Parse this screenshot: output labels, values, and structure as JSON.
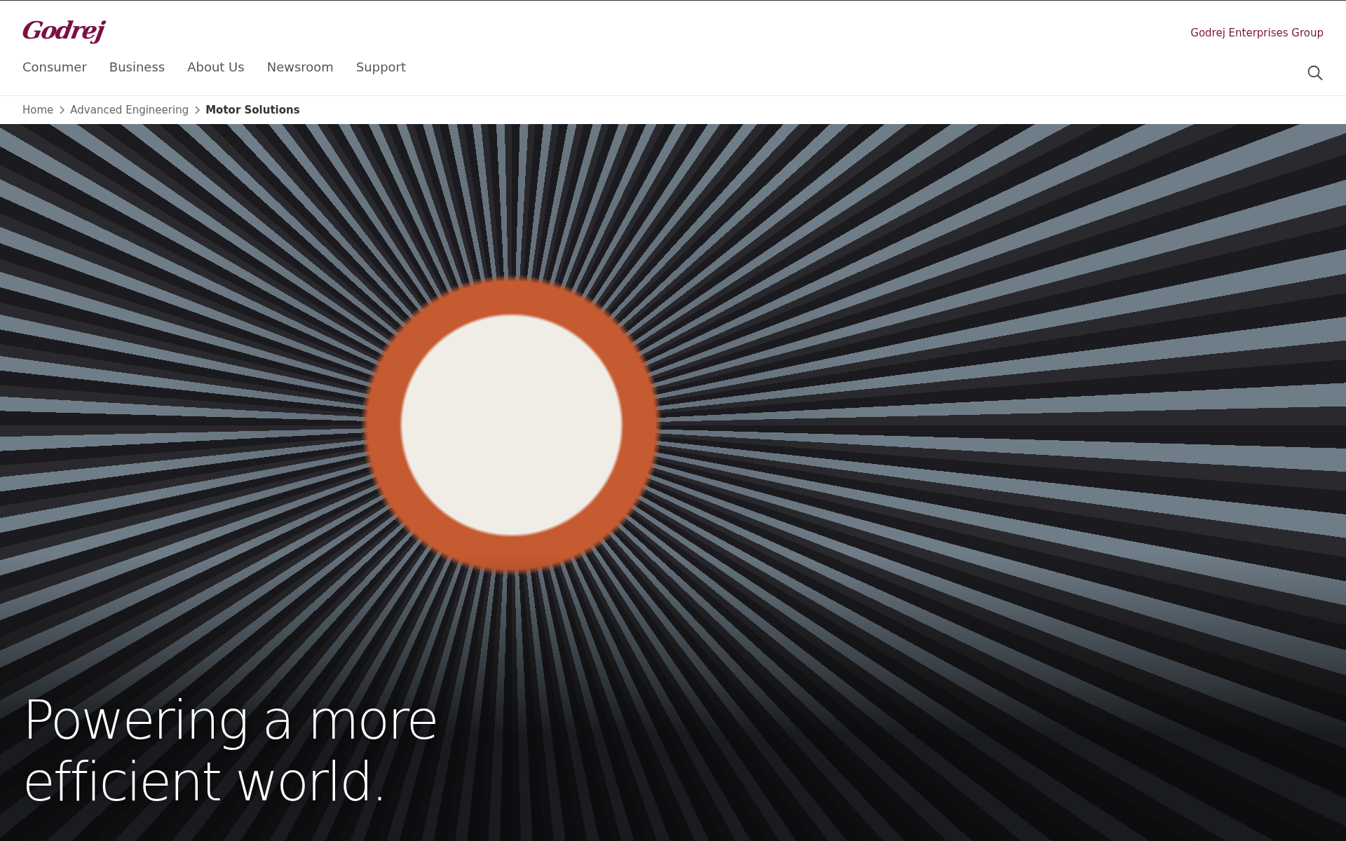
{
  "header": {
    "logo": "Godrej",
    "group_link": "Godrej Enterprises Group",
    "nav": [
      {
        "label": "Consumer"
      },
      {
        "label": "Business"
      },
      {
        "label": "About Us"
      },
      {
        "label": "Newsroom"
      },
      {
        "label": "Support"
      }
    ]
  },
  "breadcrumb": [
    {
      "label": "Home",
      "current": false
    },
    {
      "label": "Advanced Engineering",
      "current": false
    },
    {
      "label": "Motor Solutions",
      "current": true
    }
  ],
  "hero": {
    "headline": [
      "Powering a more",
      "efficient world."
    ]
  }
}
